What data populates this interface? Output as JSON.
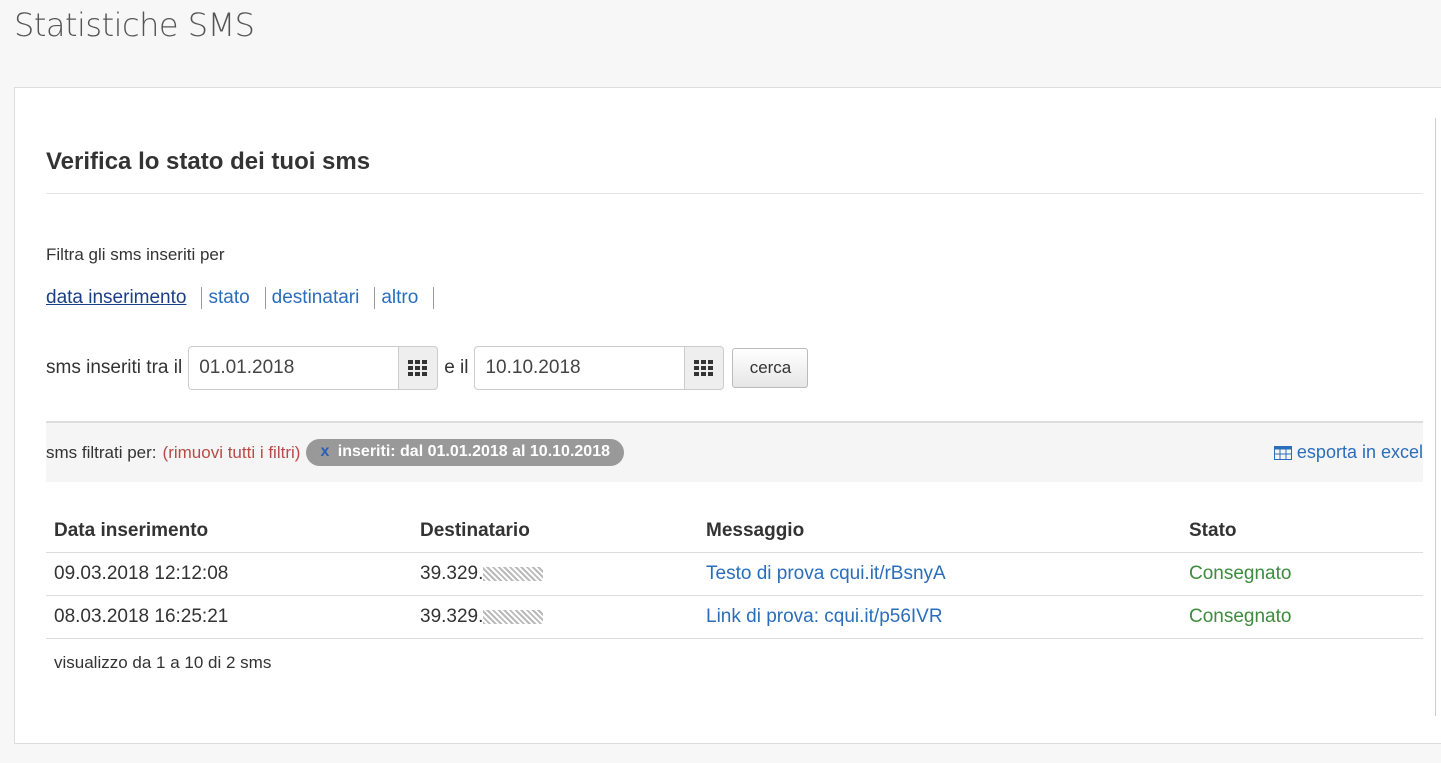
{
  "page": {
    "title": "Statistiche SMS"
  },
  "section": {
    "title": "Verifica lo stato dei tuoi sms"
  },
  "filters": {
    "intro": "Filtra gli sms inseriti per",
    "tabs": [
      {
        "label": "data inserimento",
        "active": true
      },
      {
        "label": "stato"
      },
      {
        "label": "destinatari"
      },
      {
        "label": "altro"
      }
    ]
  },
  "date_filter": {
    "label_from": "sms inseriti tra il",
    "from_value": "01.01.2018",
    "label_to": "e il",
    "to_value": "10.10.2018",
    "search_label": "cerca",
    "calendar_icon": "calendar-grid-icon"
  },
  "active_filters": {
    "label": "sms filtrati per:",
    "remove_all": "(rimuovi tutti i filtri)",
    "chip_remove": "x",
    "chip_text": "inseriti: dal 01.01.2018 al 10.10.2018",
    "export_label": "esporta in excel",
    "export_icon": "table-icon"
  },
  "table": {
    "headers": [
      "Data inserimento",
      "Destinatario",
      "Messaggio",
      "Stato"
    ],
    "rows": [
      {
        "date": "09.03.2018 12:12:08",
        "recipient": "39.329.",
        "message": "Testo di prova cqui.it/rBsnyA",
        "status": "Consegnato"
      },
      {
        "date": "08.03.2018 16:25:21",
        "recipient": "39.329.",
        "message": "Link di prova: cqui.it/p56IVR",
        "status": "Consegnato"
      }
    ],
    "summary": "visualizzo da 1 a 10 di 2 sms"
  },
  "colors": {
    "link": "#2a6ebb",
    "active_tab": "#1b3f86",
    "remove": "#b94a48",
    "status_ok": "#3c8c3c",
    "chip_bg": "#999999"
  }
}
